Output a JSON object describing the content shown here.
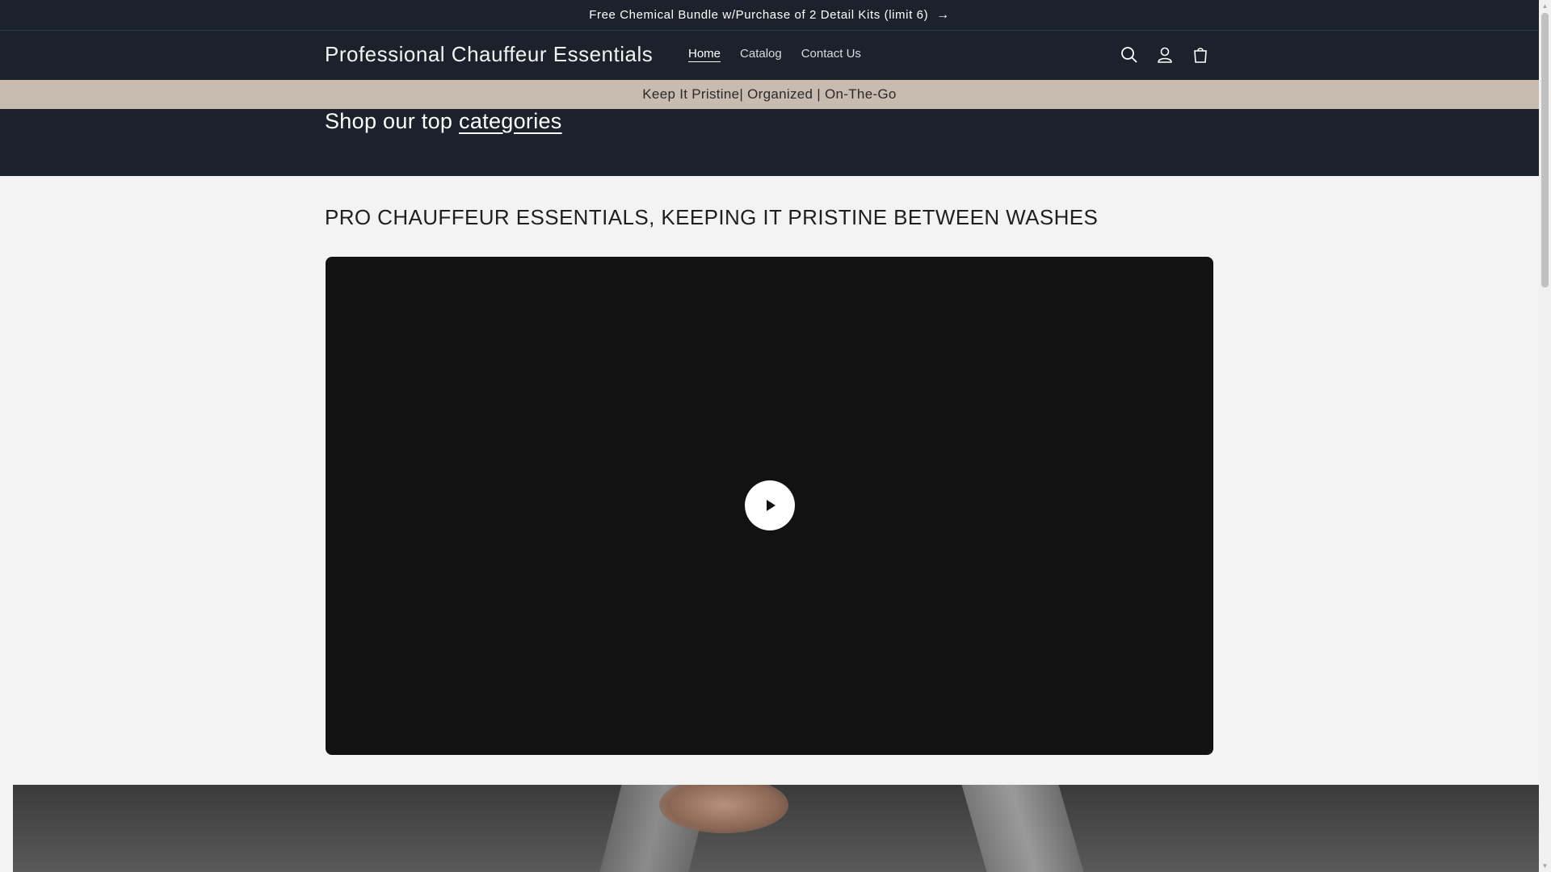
{
  "announcement": {
    "text": "Free Chemical Bundle w/Purchase of 2 Detail Kits (limit 6)",
    "arrow": "→"
  },
  "header": {
    "logo": "Professional Chauffeur Essentials",
    "nav": [
      {
        "label": "Home",
        "active": true
      },
      {
        "label": "Catalog"
      },
      {
        "label": "Contact Us"
      }
    ],
    "icons": [
      "search-icon",
      "account-icon",
      "cart-icon"
    ]
  },
  "tagline": "Keep It Pristine| Organized | On-The-Go",
  "categories": {
    "prefix": "Shop our top ",
    "link": "categories"
  },
  "main": {
    "title": "PRO CHAUFFEUR ESSENTIALS, KEEPING IT PRISTINE BETWEEN WASHES"
  },
  "colors": {
    "header_bg": "#1b222b",
    "tagline_bg": "#c8bcb1",
    "page_bg": "#f3f3f3",
    "video_bg": "#121212"
  }
}
